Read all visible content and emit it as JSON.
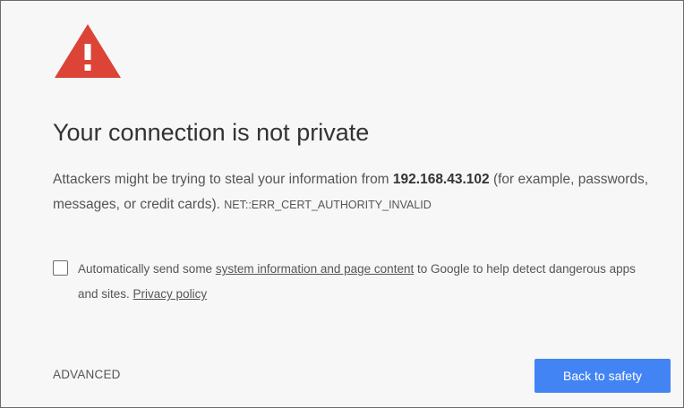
{
  "icon": {
    "name": "warning-icon",
    "color": "#db4437",
    "glyph": "!"
  },
  "heading": {
    "title": "Your connection is not private"
  },
  "message": {
    "text_before": "Attackers might be trying to steal your information from ",
    "host": "192.168.43.102",
    "text_after": " (for example, passwords, messages, or credit cards). ",
    "error_code": "NET::ERR_CERT_AUTHORITY_INVALID"
  },
  "optin": {
    "checked": false,
    "text_before": "Automatically send some ",
    "link_system_info": "system information and page content",
    "text_middle": " to Google to help detect dangerous apps and sites. ",
    "link_privacy": "Privacy policy"
  },
  "actions": {
    "advanced_label": "ADVANCED",
    "back_label": "Back to safety",
    "accent_color": "#4284f3"
  }
}
